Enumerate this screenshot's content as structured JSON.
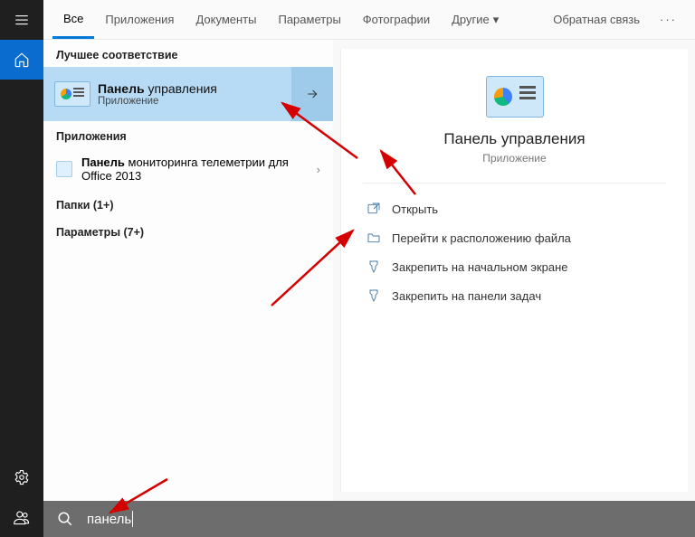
{
  "tabs": {
    "all": "Все",
    "apps": "Приложения",
    "docs": "Документы",
    "settings": "Параметры",
    "photos": "Фотографии",
    "other": "Другие",
    "feedback": "Обратная связь"
  },
  "sections": {
    "best_match": "Лучшее соответствие",
    "apps": "Приложения",
    "folders": "Папки (1+)",
    "settings": "Параметры (7+)"
  },
  "best": {
    "bold": "Панель",
    "rest": " управления",
    "type": "Приложение"
  },
  "app_item": {
    "bold": "Панель",
    "rest": " мониторинга телеметрии для Office 2013"
  },
  "preview": {
    "title": "Панель управления",
    "type": "Приложение"
  },
  "actions": {
    "open": "Открыть",
    "open_location": "Перейти к расположению файла",
    "pin_start": "Закрепить на начальном экране",
    "pin_taskbar": "Закрепить на панели задач"
  },
  "search": {
    "value": "панель"
  }
}
